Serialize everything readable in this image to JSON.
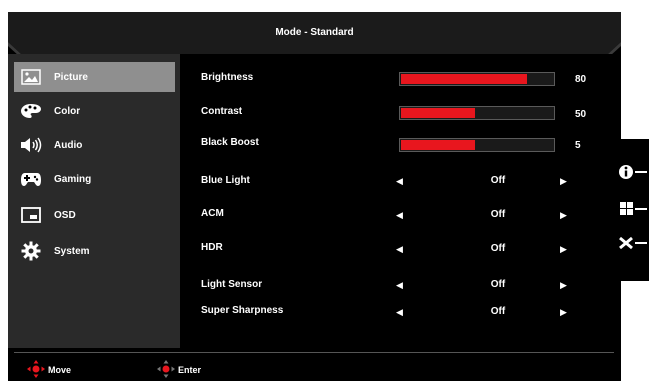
{
  "title": "Mode - Standard",
  "sidebar": {
    "items": [
      {
        "label": "Picture",
        "icon": "picture-icon",
        "active": true
      },
      {
        "label": "Color",
        "icon": "palette-icon",
        "active": false
      },
      {
        "label": "Audio",
        "icon": "speaker-icon",
        "active": false
      },
      {
        "label": "Gaming",
        "icon": "gamepad-icon",
        "active": false
      },
      {
        "label": "OSD",
        "icon": "osd-screen-icon",
        "active": false
      },
      {
        "label": "System",
        "icon": "gear-icon",
        "active": false
      }
    ]
  },
  "sliders": [
    {
      "label": "Brightness",
      "value": "80",
      "fraction": 0.83
    },
    {
      "label": "Contrast",
      "value": "50",
      "fraction": 0.49
    },
    {
      "label": "Black Boost",
      "value": "5",
      "fraction": 0.49
    }
  ],
  "options": [
    {
      "label": "Blue Light",
      "value": "Off"
    },
    {
      "label": "ACM",
      "value": "Off"
    },
    {
      "label": "HDR",
      "value": "Off"
    },
    {
      "label": "Light Sensor",
      "value": "Off"
    },
    {
      "label": "Super Sharpness",
      "value": "Off"
    }
  ],
  "footer": {
    "move_label": "Move",
    "enter_label": "Enter"
  },
  "side_buttons": [
    "info-icon",
    "modes-grid-icon",
    "close-icon"
  ],
  "colors": {
    "accent": "#e8161e",
    "active_item": "#8f8f8f",
    "panel": "#2a2a2a"
  }
}
